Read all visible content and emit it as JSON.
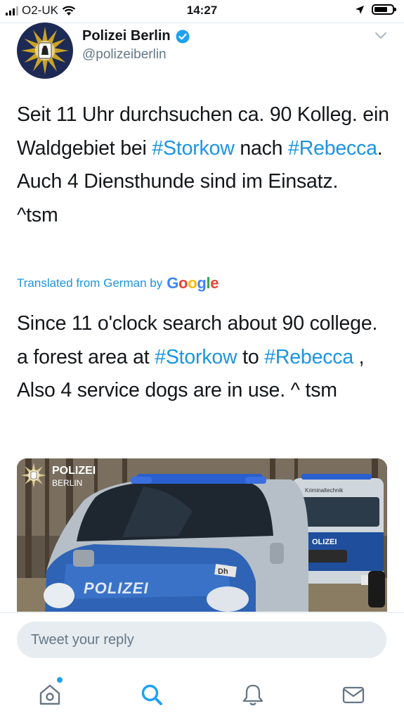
{
  "status_bar": {
    "carrier": "O2-UK",
    "time": "14:27",
    "icons": [
      "signal-icon",
      "wifi-icon",
      "location-arrow-icon",
      "battery-icon"
    ]
  },
  "tweet": {
    "author_name": "Polizei Berlin",
    "author_handle": "@polizeiberlin",
    "verified": true,
    "text": {
      "p1": "Seit 11 Uhr durchsuchen ca. 90 Kolleg. ein Waldgebiet bei ",
      "tag1": "#Storkow",
      "p2": " nach ",
      "tag2": "#Rebecca",
      "p3": ". Auch 4 Diensthunde sind im Einsatz.",
      "signoff": "^tsm"
    },
    "translation_label": "Translated from German by",
    "translation_provider": "Google",
    "translation": {
      "p1": "Since 11 o'clock search about 90 college. a forest area at ",
      "tag1": "#Storkow",
      "p2": " to ",
      "tag2": "#Rebecca",
      "p3": " , Also 4 service dogs are in use. ^ tsm"
    },
    "media": {
      "logo_line1": "POLIZEI",
      "logo_line2": "BERLIN",
      "van_text": "POLIZEI",
      "van_small": "Dh",
      "rear_van_text": "Kriminaltechnik",
      "rear_van_label": "OLIZEI"
    }
  },
  "reply": {
    "placeholder": "Tweet your reply"
  },
  "tab_bar": {
    "tabs": [
      "home-icon",
      "search-icon",
      "notifications-icon",
      "messages-icon"
    ],
    "active": "search-icon"
  },
  "colors": {
    "link": "#1b95e0",
    "accent": "#1da1f2",
    "muted": "#657786",
    "reply_bg": "#e6ecf0"
  }
}
